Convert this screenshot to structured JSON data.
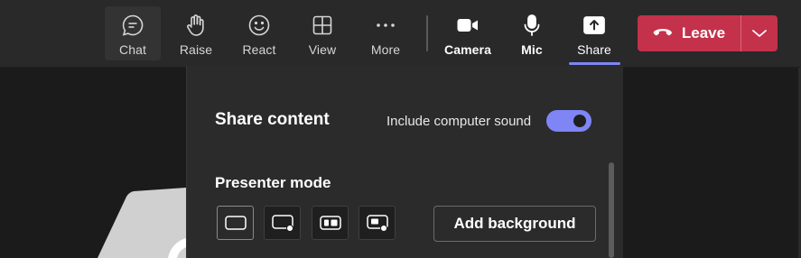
{
  "toolbar": {
    "chat_label": "Chat",
    "raise_label": "Raise",
    "react_label": "React",
    "view_label": "View",
    "more_label": "More",
    "camera_label": "Camera",
    "mic_label": "Mic",
    "share_label": "Share",
    "leave_label": "Leave",
    "icons": {
      "chat": "chat-bubble-icon",
      "raise": "raise-hand-icon",
      "react": "smiley-icon",
      "view": "grid-view-icon",
      "more": "more-dots-icon",
      "camera": "camera-icon",
      "mic": "mic-icon",
      "share": "share-tray-icon",
      "leave": "phone-hangup-icon",
      "leave_dropdown": "chevron-down-icon"
    }
  },
  "share_panel": {
    "title": "Share content",
    "sound_label": "Include computer sound",
    "sound_enabled": true,
    "presenter_mode_title": "Presenter mode",
    "presenter_modes": [
      {
        "name": "content-only",
        "selected": true
      },
      {
        "name": "standout",
        "selected": false
      },
      {
        "name": "side-by-side",
        "selected": false
      },
      {
        "name": "reporter",
        "selected": false
      }
    ],
    "add_background_label": "Add background"
  },
  "colors": {
    "accent": "#7f85f5",
    "leave": "#c4314b",
    "toolbar_bg": "#292929",
    "panel_bg": "#2b2b2b",
    "stage_bg": "#1b1b1b"
  }
}
